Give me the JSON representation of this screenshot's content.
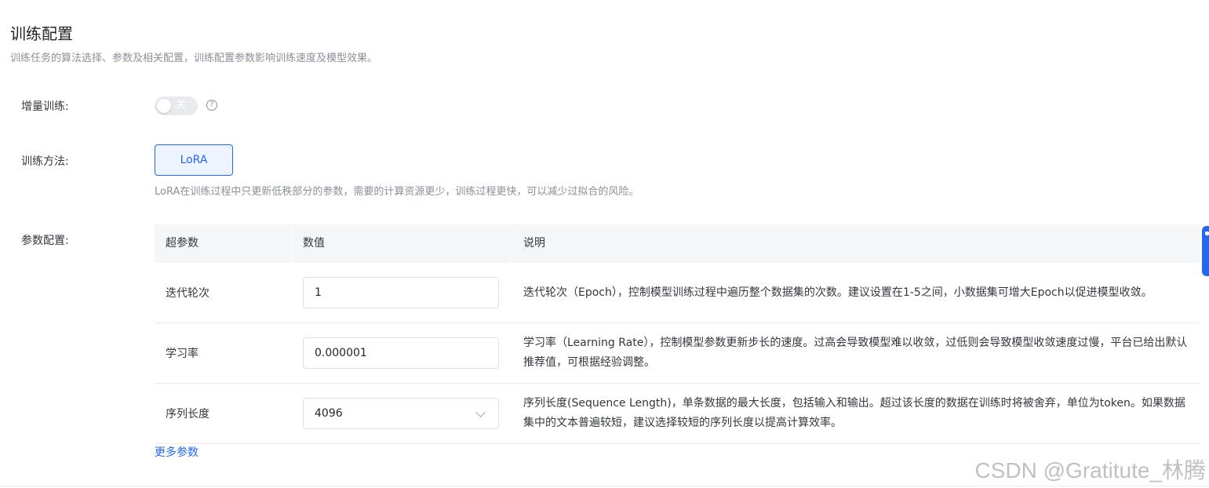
{
  "section": {
    "title": "训练配置",
    "description": "训练任务的算法选择、参数及相关配置，训练配置参数影响训练速度及模型效果。"
  },
  "incremental": {
    "label": "增量训练:",
    "switch_text": "关",
    "switch_on": false,
    "help_glyph": "?"
  },
  "method": {
    "label": "训练方法:",
    "selected": "LoRA",
    "description": "LoRA在训练过程中只更新低秩部分的参数，需要的计算资源更少，训练过程更快，可以减少过拟合的风险。"
  },
  "params": {
    "label": "参数配置:",
    "columns": [
      "超参数",
      "数值",
      "说明"
    ],
    "rows": [
      {
        "name": "迭代轮次",
        "value": "1",
        "type": "input",
        "desc": "迭代轮次（Epoch），控制模型训练过程中遍历整个数据集的次数。建议设置在1-5之间，小数据集可增大Epoch以促进模型收敛。"
      },
      {
        "name": "学习率",
        "value": "0.000001",
        "type": "input",
        "desc": "学习率（Learning Rate），控制模型参数更新步长的速度。过高会导致模型难以收敛，过低则会导致模型收敛速度过慢，平台已给出默认推荐值，可根据经验调整。"
      },
      {
        "name": "序列长度",
        "value": "4096",
        "type": "select",
        "desc": "序列长度(Sequence Length)，单条数据的最大长度，包括输入和输出。超过该长度的数据在训练时将被舍弃，单位为token。如果数据集中的文本普遍较短，建议选择较短的序列长度以提高计算效率。"
      }
    ],
    "more_link": "更多参数"
  },
  "watermark": "CSDN @Gratitute_林腾",
  "colors": {
    "accent": "#2468f2",
    "muted_text": "#8a8f99",
    "table_header_bg": "#f5f6f8"
  }
}
